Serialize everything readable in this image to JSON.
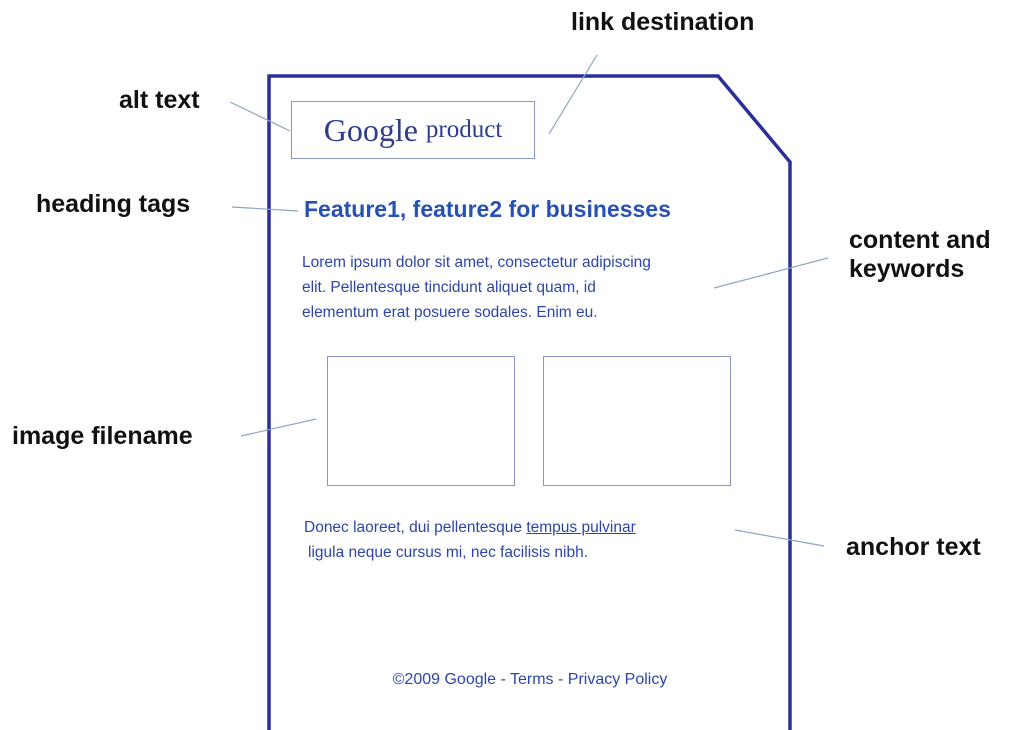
{
  "callouts": {
    "link_destination": "link destination",
    "alt_text": "alt text",
    "heading_tags": "heading tags",
    "content_keywords_line1": "content and",
    "content_keywords_line2": "keywords",
    "image_filename": "image filename",
    "anchor_text": "anchor text"
  },
  "mockup": {
    "logo_word": "Google",
    "logo_product": "product",
    "heading": "Feature1, feature2 for businesses",
    "paragraph_lines": [
      "Lorem ipsum dolor sit amet, consectetur adipiscing",
      "elit. Pellentesque tincidunt aliquet quam, id",
      "elementum erat posuere sodales. Enim eu."
    ],
    "second_paragraph": {
      "line1_before_link": "Donec laoreet, dui pellentesque ",
      "link_text": "tempus pulvinar",
      "line2": "ligula neque cursus mi, nec facilisis nibh."
    },
    "footer": {
      "copyright": "©2009 Google",
      "separator": " - ",
      "terms": "Terms",
      "separator2": " - ",
      "privacy": "Privacy Policy"
    }
  },
  "colors": {
    "page_outline": "#2a2f9a",
    "text_blue": "#2d45a8",
    "callout_line": "#8fa4c8"
  }
}
